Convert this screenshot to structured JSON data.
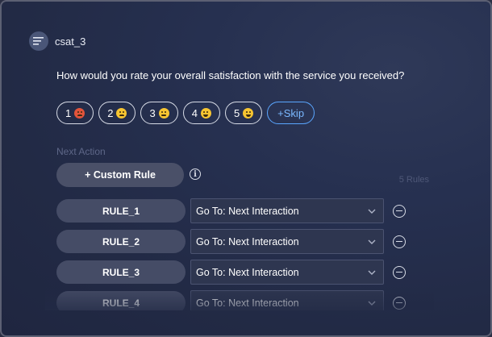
{
  "header": {
    "title": "csat_3",
    "icon": "lines-icon"
  },
  "question": "How would you rate your overall satisfaction with the service you received?",
  "choices": [
    {
      "label": "1",
      "emoji": "angry-face-icon"
    },
    {
      "label": "2",
      "emoji": "sad-face-icon"
    },
    {
      "label": "3",
      "emoji": "neutral-face-icon"
    },
    {
      "label": "4",
      "emoji": "smile-face-icon"
    },
    {
      "label": "5",
      "emoji": "happy-face-icon"
    }
  ],
  "skip_label": "+Skip",
  "next_action": {
    "label": "Next Action",
    "custom_rule_label": "+ Custom Rule",
    "rule_count": "5 Rules",
    "rules": [
      {
        "name": "RULE_1",
        "action": "Go To: Next Interaction"
      },
      {
        "name": "RULE_2",
        "action": "Go To: Next Interaction"
      },
      {
        "name": "RULE_3",
        "action": "Go To: Next Interaction"
      },
      {
        "name": "RULE_4",
        "action": "Go To: Next Interaction"
      }
    ]
  },
  "colors": {
    "accent": "#5aa6ff",
    "background": "#222a45"
  }
}
